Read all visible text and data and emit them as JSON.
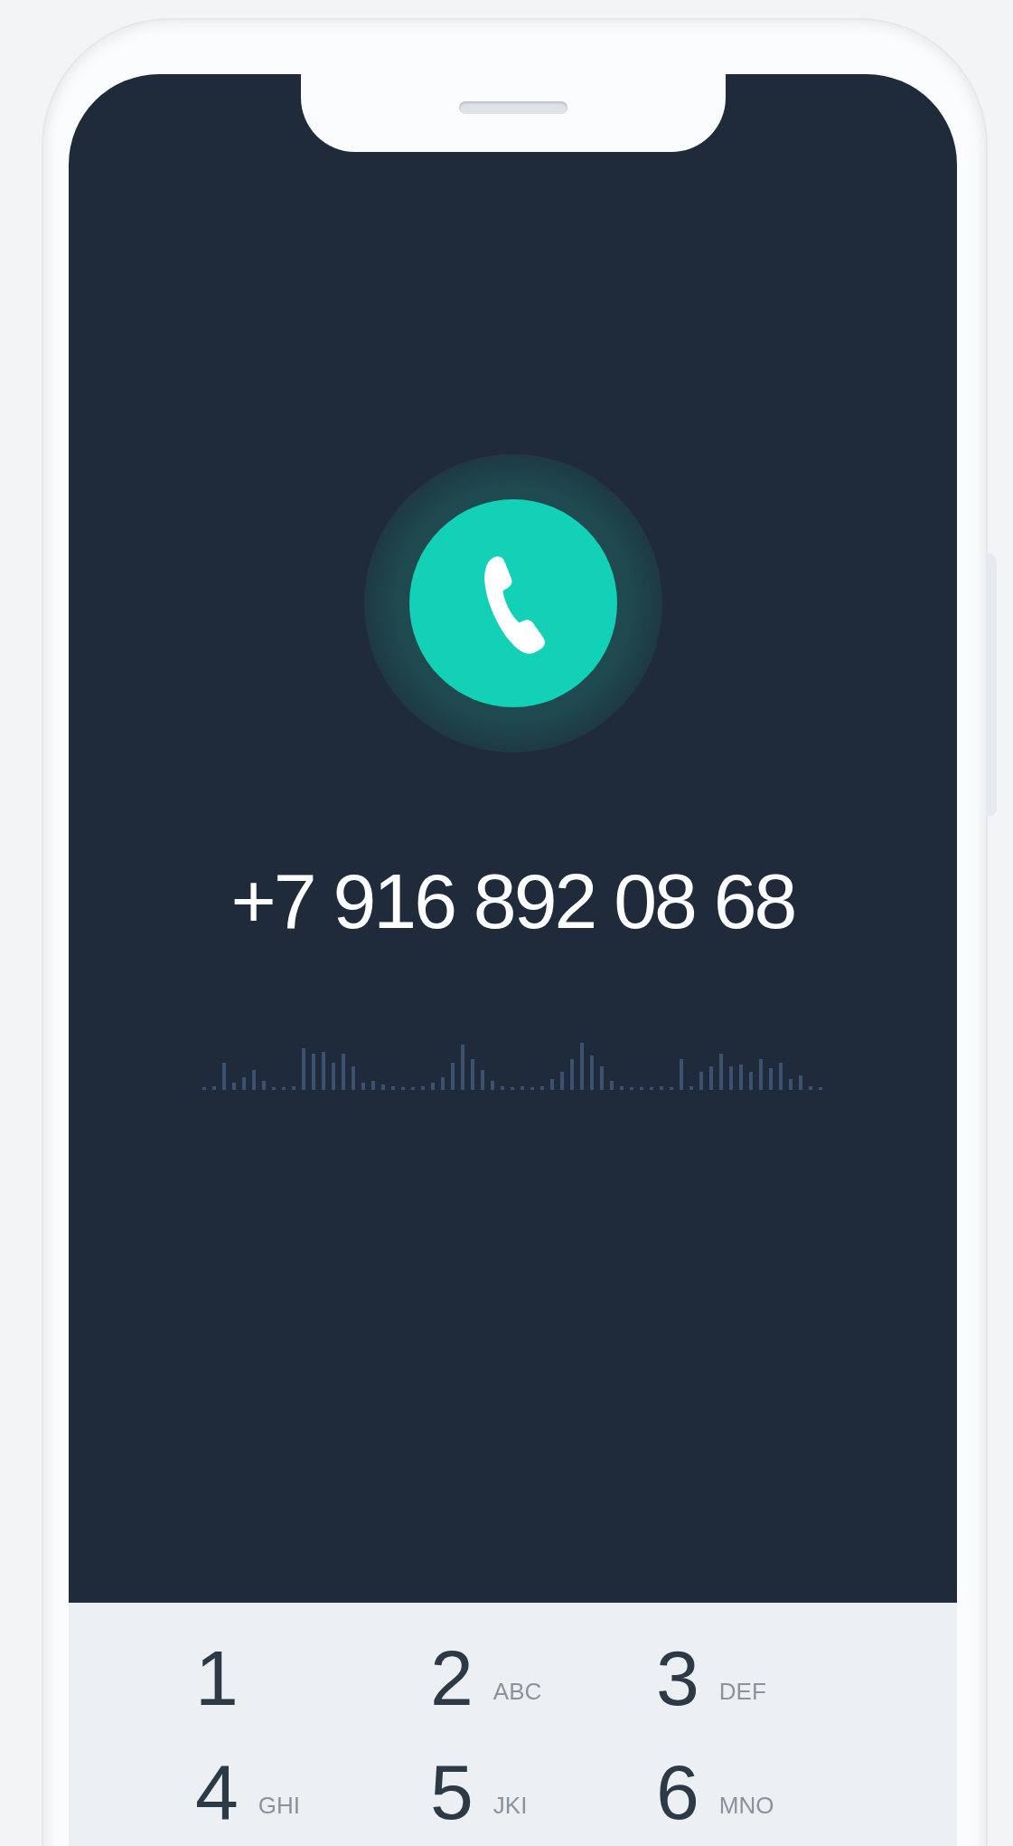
{
  "call": {
    "number": "+7 916 892 08 68"
  },
  "keypad": [
    {
      "digit": "1"
    },
    {
      "digit": "2",
      "letters": "ABC"
    },
    {
      "digit": "3",
      "letters": "DEF"
    },
    {
      "digit": "4",
      "letters": "GHI"
    },
    {
      "digit": "5",
      "letters": "JKI"
    },
    {
      "digit": "6",
      "letters": "MNO"
    }
  ]
}
